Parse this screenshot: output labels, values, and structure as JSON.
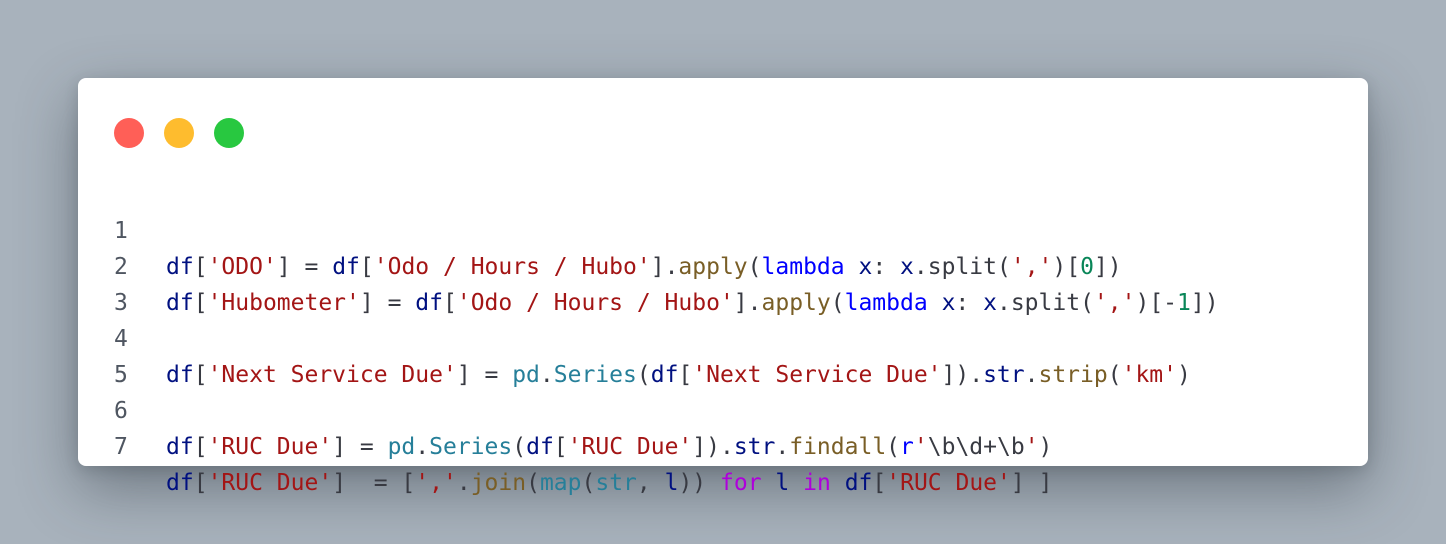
{
  "window": {
    "controls": [
      {
        "name": "close",
        "color": "#ff5f57"
      },
      {
        "name": "minimize",
        "color": "#febc2e"
      },
      {
        "name": "maximize",
        "color": "#28c840"
      }
    ]
  },
  "code": {
    "language": "python",
    "lines": [
      {
        "number": "1",
        "tokens": [
          {
            "t": "df",
            "k": "id"
          },
          {
            "t": "[",
            "k": "op"
          },
          {
            "t": "'ODO'",
            "k": "str"
          },
          {
            "t": "] = ",
            "k": "op"
          },
          {
            "t": "df",
            "k": "id"
          },
          {
            "t": "[",
            "k": "op"
          },
          {
            "t": "'Odo / Hours / Hubo'",
            "k": "str"
          },
          {
            "t": "].",
            "k": "op"
          },
          {
            "t": "apply",
            "k": "fn"
          },
          {
            "t": "(",
            "k": "op"
          },
          {
            "t": "lambda",
            "k": "kw"
          },
          {
            "t": " ",
            "k": "op"
          },
          {
            "t": "x",
            "k": "id"
          },
          {
            "t": ": ",
            "k": "op"
          },
          {
            "t": "x",
            "k": "id"
          },
          {
            "t": ".split(",
            "k": "op"
          },
          {
            "t": "','",
            "k": "str"
          },
          {
            "t": ")[",
            "k": "op"
          },
          {
            "t": "0",
            "k": "num"
          },
          {
            "t": "])",
            "k": "op"
          }
        ]
      },
      {
        "number": "2",
        "tokens": [
          {
            "t": "df",
            "k": "id"
          },
          {
            "t": "[",
            "k": "op"
          },
          {
            "t": "'Hubometer'",
            "k": "str"
          },
          {
            "t": "] = ",
            "k": "op"
          },
          {
            "t": "df",
            "k": "id"
          },
          {
            "t": "[",
            "k": "op"
          },
          {
            "t": "'Odo / Hours / Hubo'",
            "k": "str"
          },
          {
            "t": "].",
            "k": "op"
          },
          {
            "t": "apply",
            "k": "fn"
          },
          {
            "t": "(",
            "k": "op"
          },
          {
            "t": "lambda",
            "k": "kw"
          },
          {
            "t": " ",
            "k": "op"
          },
          {
            "t": "x",
            "k": "id"
          },
          {
            "t": ": ",
            "k": "op"
          },
          {
            "t": "x",
            "k": "id"
          },
          {
            "t": ".split(",
            "k": "op"
          },
          {
            "t": "','",
            "k": "str"
          },
          {
            "t": ")[-",
            "k": "op"
          },
          {
            "t": "1",
            "k": "num"
          },
          {
            "t": "])",
            "k": "op"
          }
        ]
      },
      {
        "number": "3",
        "tokens": []
      },
      {
        "number": "4",
        "tokens": [
          {
            "t": "df",
            "k": "id"
          },
          {
            "t": "[",
            "k": "op"
          },
          {
            "t": "'Next Service Due'",
            "k": "str"
          },
          {
            "t": "] = ",
            "k": "op"
          },
          {
            "t": "pd",
            "k": "mod"
          },
          {
            "t": ".",
            "k": "op"
          },
          {
            "t": "Series",
            "k": "mod"
          },
          {
            "t": "(",
            "k": "op"
          },
          {
            "t": "df",
            "k": "id"
          },
          {
            "t": "[",
            "k": "op"
          },
          {
            "t": "'Next Service Due'",
            "k": "str"
          },
          {
            "t": "]).",
            "k": "op"
          },
          {
            "t": "str",
            "k": "id"
          },
          {
            "t": ".",
            "k": "op"
          },
          {
            "t": "strip",
            "k": "fn"
          },
          {
            "t": "(",
            "k": "op"
          },
          {
            "t": "'km'",
            "k": "str"
          },
          {
            "t": ")",
            "k": "op"
          }
        ]
      },
      {
        "number": "5",
        "tokens": []
      },
      {
        "number": "6",
        "tokens": [
          {
            "t": "df",
            "k": "id"
          },
          {
            "t": "[",
            "k": "op"
          },
          {
            "t": "'RUC Due'",
            "k": "str"
          },
          {
            "t": "] = ",
            "k": "op"
          },
          {
            "t": "pd",
            "k": "mod"
          },
          {
            "t": ".",
            "k": "op"
          },
          {
            "t": "Series",
            "k": "mod"
          },
          {
            "t": "(",
            "k": "op"
          },
          {
            "t": "df",
            "k": "id"
          },
          {
            "t": "[",
            "k": "op"
          },
          {
            "t": "'RUC Due'",
            "k": "str"
          },
          {
            "t": "]).",
            "k": "op"
          },
          {
            "t": "str",
            "k": "id"
          },
          {
            "t": ".",
            "k": "op"
          },
          {
            "t": "findall",
            "k": "fn"
          },
          {
            "t": "(",
            "k": "op"
          },
          {
            "t": "r",
            "k": "kw"
          },
          {
            "t": "'",
            "k": "str"
          },
          {
            "t": "\\b\\d+\\b",
            "k": "esc"
          },
          {
            "t": "'",
            "k": "str"
          },
          {
            "t": ")",
            "k": "op"
          }
        ]
      },
      {
        "number": "7",
        "tokens": [
          {
            "t": "df",
            "k": "id"
          },
          {
            "t": "[",
            "k": "op"
          },
          {
            "t": "'RUC Due'",
            "k": "str"
          },
          {
            "t": "]  = [",
            "k": "op"
          },
          {
            "t": "','",
            "k": "str"
          },
          {
            "t": ".",
            "k": "op"
          },
          {
            "t": "join",
            "k": "fn"
          },
          {
            "t": "(",
            "k": "op"
          },
          {
            "t": "map",
            "k": "mod"
          },
          {
            "t": "(",
            "k": "op"
          },
          {
            "t": "str",
            "k": "mod"
          },
          {
            "t": ", ",
            "k": "op"
          },
          {
            "t": "l",
            "k": "id"
          },
          {
            "t": ")) ",
            "k": "op"
          },
          {
            "t": "for",
            "k": "ctl"
          },
          {
            "t": " ",
            "k": "op"
          },
          {
            "t": "l",
            "k": "id"
          },
          {
            "t": " ",
            "k": "op"
          },
          {
            "t": "in",
            "k": "ctl"
          },
          {
            "t": " ",
            "k": "op"
          },
          {
            "t": "df",
            "k": "id"
          },
          {
            "t": "[",
            "k": "op"
          },
          {
            "t": "'RUC Due'",
            "k": "str"
          },
          {
            "t": "] ]",
            "k": "op"
          }
        ]
      }
    ]
  }
}
